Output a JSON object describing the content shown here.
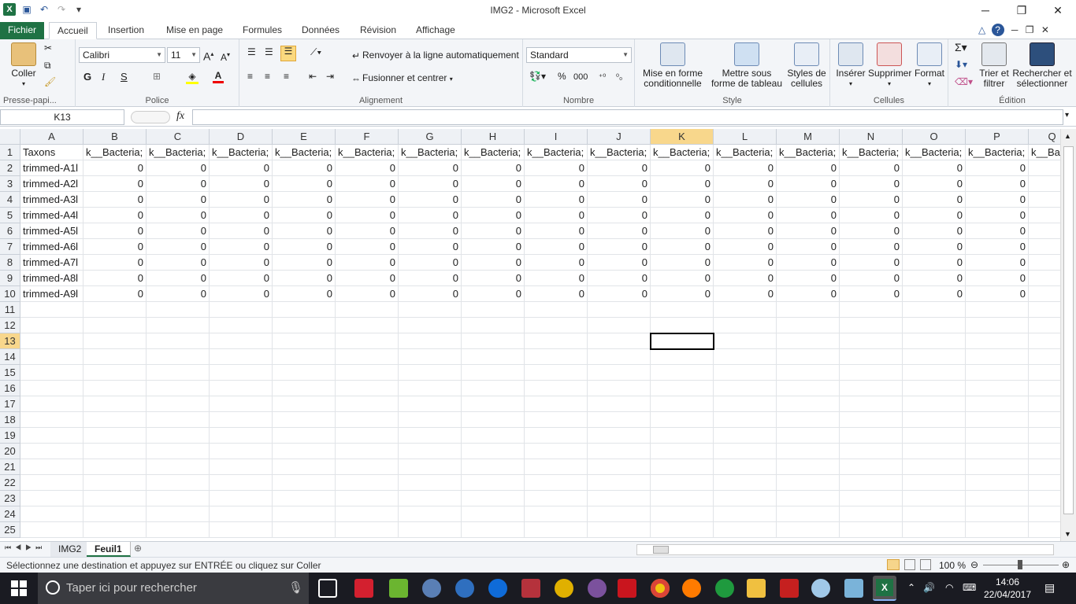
{
  "window": {
    "title": "IMG2  -  Microsoft Excel"
  },
  "tabs": [
    "Fichier",
    "Accueil",
    "Insertion",
    "Mise en page",
    "Formules",
    "Données",
    "Révision",
    "Affichage"
  ],
  "ribbon": {
    "clipboard": {
      "paste": "Coller",
      "label": "Presse-papi..."
    },
    "font": {
      "name": "Calibri",
      "size": "11",
      "bold": "G",
      "italic": "I",
      "underline": "S",
      "label": "Police"
    },
    "alignment": {
      "wrap": "Renvoyer à la ligne automatiquement",
      "merge": "Fusionner et centrer",
      "label": "Alignement"
    },
    "number": {
      "format": "Standard",
      "percent": "%",
      "thousands": "000",
      "label": "Nombre"
    },
    "style": {
      "conditional": "Mise en forme conditionnelle",
      "table": "Mettre sous forme de tableau",
      "cellstyles": "Styles de cellules",
      "label": "Style"
    },
    "cells": {
      "insert": "Insérer",
      "delete": "Supprimer",
      "format": "Format",
      "label": "Cellules"
    },
    "editing": {
      "sort": "Trier et filtrer",
      "find": "Rechercher et sélectionner",
      "label": "Édition"
    }
  },
  "formula_bar": {
    "name_box": "K13",
    "fx": "fx",
    "value": ""
  },
  "columns": [
    "A",
    "B",
    "C",
    "D",
    "E",
    "F",
    "G",
    "H",
    "I",
    "J",
    "K",
    "L",
    "M",
    "N",
    "O",
    "P",
    "Q"
  ],
  "rows": [
    "1",
    "2",
    "3",
    "4",
    "5",
    "6",
    "7",
    "8",
    "9",
    "10",
    "11",
    "12",
    "13",
    "14",
    "15",
    "16",
    "17",
    "18",
    "19",
    "20",
    "21",
    "22",
    "23",
    "24",
    "25"
  ],
  "header_row": [
    "Taxons",
    "k__Bacteria;",
    "k__Bacteria;",
    "k__Bacteria;",
    "k__Bacteria;",
    "k__Bacteria;",
    "k__Bacteria;",
    "k__Bacteria;",
    "k__Bacteria;",
    "k__Bacteria;",
    "k__Bacteria;",
    "k__Bacteria;",
    "k__Bacteria;",
    "k__Bacteria;",
    "k__Bacteria;",
    "k__Bacteria;",
    "k__Bac"
  ],
  "data_rows": [
    {
      "taxon": "trimmed-A1l",
      "values": [
        "0",
        "0",
        "0",
        "0",
        "0",
        "0",
        "0",
        "0",
        "0",
        "0",
        "0",
        "0",
        "0",
        "0",
        "0"
      ]
    },
    {
      "taxon": "trimmed-A2l",
      "values": [
        "0",
        "0",
        "0",
        "0",
        "0",
        "0",
        "0",
        "0",
        "0",
        "0",
        "0",
        "0",
        "0",
        "0",
        "0"
      ]
    },
    {
      "taxon": "trimmed-A3l",
      "values": [
        "0",
        "0",
        "0",
        "0",
        "0",
        "0",
        "0",
        "0",
        "0",
        "0",
        "0",
        "0",
        "0",
        "0",
        "0"
      ]
    },
    {
      "taxon": "trimmed-A4l",
      "values": [
        "0",
        "0",
        "0",
        "0",
        "0",
        "0",
        "0",
        "0",
        "0",
        "0",
        "0",
        "0",
        "0",
        "0",
        "0"
      ]
    },
    {
      "taxon": "trimmed-A5l",
      "values": [
        "0",
        "0",
        "0",
        "0",
        "0",
        "0",
        "0",
        "0",
        "0",
        "0",
        "0",
        "0",
        "0",
        "0",
        "0"
      ]
    },
    {
      "taxon": "trimmed-A6l",
      "values": [
        "0",
        "0",
        "0",
        "0",
        "0",
        "0",
        "0",
        "0",
        "0",
        "0",
        "0",
        "0",
        "0",
        "0",
        "0"
      ]
    },
    {
      "taxon": "trimmed-A7l",
      "values": [
        "0",
        "0",
        "0",
        "0",
        "0",
        "0",
        "0",
        "0",
        "0",
        "0",
        "0",
        "0",
        "0",
        "0",
        "0"
      ]
    },
    {
      "taxon": "trimmed-A8l",
      "values": [
        "0",
        "0",
        "0",
        "0",
        "0",
        "0",
        "0",
        "0",
        "0",
        "0",
        "0",
        "0",
        "0",
        "0",
        "0"
      ]
    },
    {
      "taxon": "trimmed-A9l",
      "values": [
        "0",
        "0",
        "0",
        "0",
        "0",
        "0",
        "0",
        "0",
        "0",
        "0",
        "0",
        "0",
        "0",
        "0",
        "0"
      ]
    }
  ],
  "selected_cell": "K13",
  "sheets": [
    "IMG2",
    "Feuil1"
  ],
  "active_sheet": "Feuil1",
  "status": {
    "message": "Sélectionnez une destination et appuyez sur ENTRÉE ou cliquez sur Coller",
    "zoom": "100 %"
  },
  "taskbar": {
    "search_placeholder": "Taper ici pour rechercher",
    "time": "14:06",
    "date": "22/04/2017"
  },
  "colors": {
    "excel_green": "#1f7244",
    "highlight": "#f8d78c"
  }
}
